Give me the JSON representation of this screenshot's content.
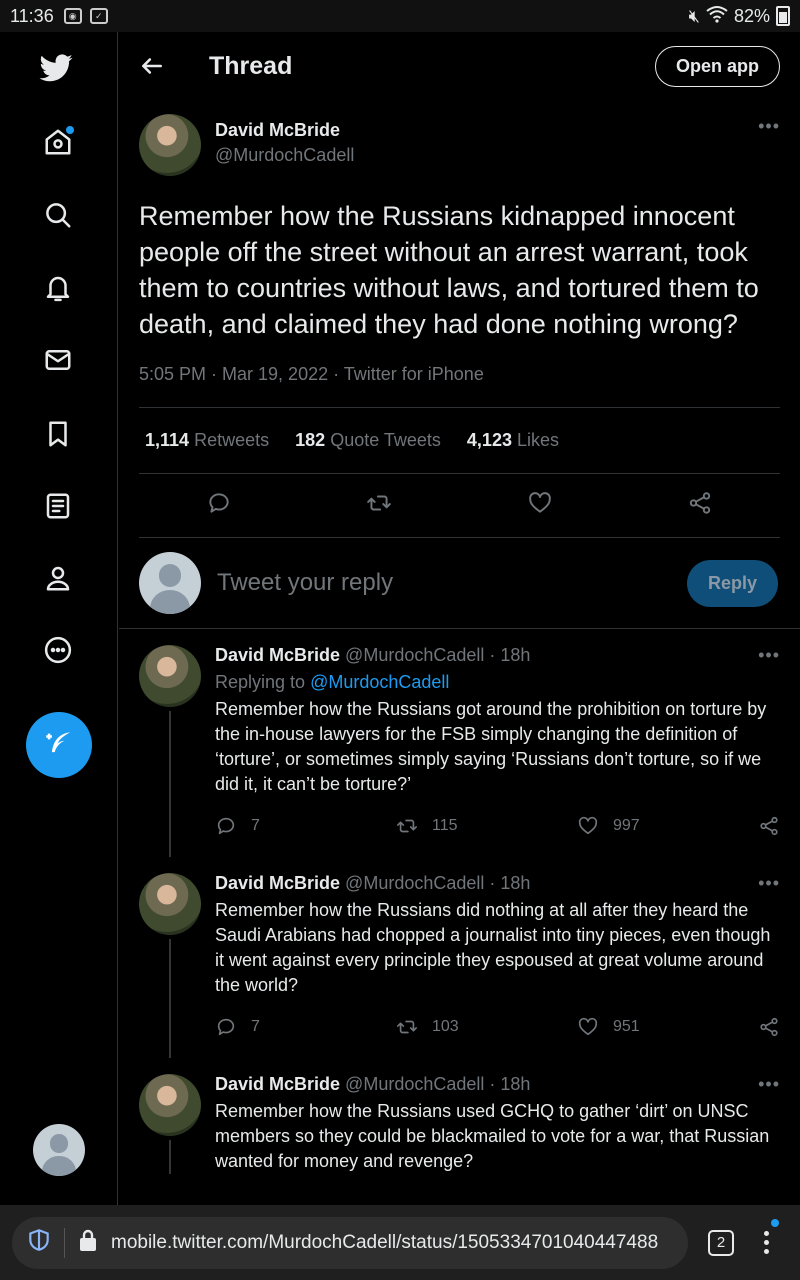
{
  "status_bar": {
    "time": "11:36",
    "battery": "82%"
  },
  "header": {
    "title": "Thread",
    "open_app": "Open app"
  },
  "main_tweet": {
    "name": "David McBride",
    "handle": "@MurdochCadell",
    "text": "Remember how the Russians kidnapped innocent people off the street without an arrest warrant, took them to countries without laws, and tortured them to death, and claimed they had done nothing wrong?",
    "meta": "5:05 PM · Mar 19, 2022 · Twitter for iPhone",
    "retweets": "1,114",
    "retweets_label": "Retweets",
    "quotes": "182",
    "quotes_label": "Quote Tweets",
    "likes": "4,123",
    "likes_label": "Likes"
  },
  "reply_box": {
    "placeholder": "Tweet your reply",
    "button": "Reply"
  },
  "replies": [
    {
      "name": "David McBride",
      "handle": "@MurdochCadell · 18h",
      "replying_prefix": "Replying to ",
      "replying_to": "@MurdochCadell",
      "text": "Remember how the Russians got around the prohibition on torture by the in-house lawyers for the FSB simply changing the definition of ‘torture’, or sometimes simply saying ‘Russians don’t torture, so if we did it,  it can’t be torture?’",
      "replies": "7",
      "retweets": "115",
      "likes": "997"
    },
    {
      "name": "David McBride",
      "handle": "@MurdochCadell · 18h",
      "text": "Remember how the Russians did nothing at all after they heard the Saudi Arabians had chopped a journalist into tiny pieces, even though it went against every principle they espoused at great volume around the world?",
      "replies": "7",
      "retweets": "103",
      "likes": "951"
    },
    {
      "name": "David McBride",
      "handle": "@MurdochCadell · 18h",
      "text": "Remember how the Russians used GCHQ to gather ‘dirt’ on UNSC members so they could be blackmailed to vote for a war, that Russian wanted for money and revenge?"
    }
  ],
  "browser": {
    "url": "mobile.twitter.com/MurdochCadell/status/1505334701040447488",
    "tabs": "2"
  },
  "colors": {
    "accent": "#1d9bf0",
    "background": "#000000",
    "muted": "#71767b"
  }
}
